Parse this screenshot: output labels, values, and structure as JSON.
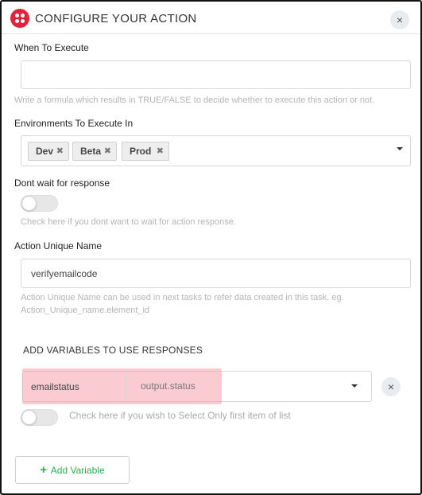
{
  "header": {
    "title": "CONFIGURE YOUR ACTION",
    "close_icon": "×",
    "brand_color": "#e3223c"
  },
  "when_to_execute": {
    "label": "When To Execute",
    "value": "",
    "help": "Write a formula which results in TRUE/FALSE to decide whether to execute this action or not."
  },
  "environments": {
    "label": "Environments To Execute In",
    "chips": [
      {
        "label": "Dev",
        "remove": "✖"
      },
      {
        "label": "Beta",
        "remove": "✖"
      },
      {
        "label": "Prod",
        "remove": "✖"
      }
    ]
  },
  "dont_wait": {
    "label": "Dont wait for response",
    "toggle_on": false,
    "help": "Check here if you dont want to wait for action response."
  },
  "unique_name": {
    "label": "Action Unique Name",
    "value": "verifyemailcode",
    "help_line1": "Action Unique Name can be used in next tasks to refer data created in this task. eg.",
    "help_line2": "Action_Unique_name.element_id"
  },
  "variables": {
    "section_title": "ADD VARIABLES TO USE RESPONSES",
    "rows": [
      {
        "name": "emailstatus",
        "path": "output.status",
        "remove_icon": "×"
      }
    ],
    "first_item_label": "Check here if you wish to Select Only first item of list",
    "first_item_on": false
  },
  "add_variable": {
    "plus": "+",
    "label": "Add Variable",
    "color": "#2eac4e"
  }
}
